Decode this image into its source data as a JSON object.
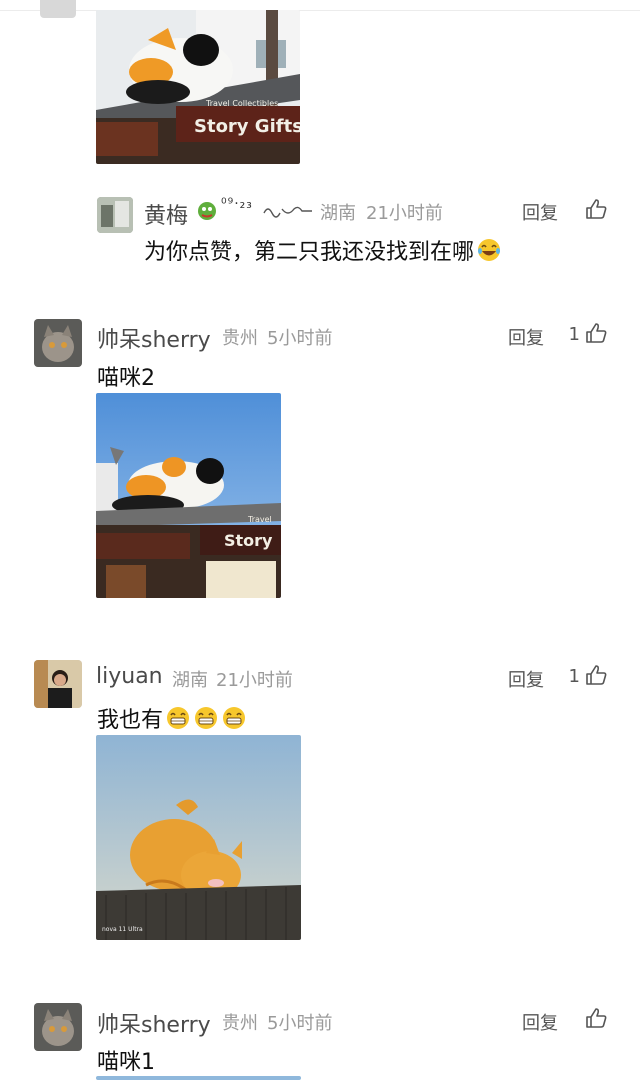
{
  "reply_label": "回复",
  "comments": [
    {
      "user": "黄梅",
      "name_suffix": "⁰⁹·₂₃",
      "location": "湖南",
      "time": "21小时前",
      "text": "为你点赞，第二只我还没找到在哪",
      "likes": ""
    },
    {
      "user": "帅呆sherry",
      "location": "贵州",
      "time": "5小时前",
      "text": "喵咪2",
      "likes": "1",
      "image": {
        "sign_en": "Story",
        "sign_small": "Travel"
      }
    },
    {
      "user": "liyuan",
      "location": "湖南",
      "time": "21小时前",
      "text": "我也有",
      "likes": "1",
      "image": {
        "watermark": "nova 11 Ultra"
      }
    },
    {
      "user": "帅呆sherry",
      "location": "贵州",
      "time": "5小时前",
      "text": "喵咪1",
      "likes": ""
    }
  ],
  "top_image": {
    "sign_en": "Story Gifts",
    "sign_small": "Travel Collectibles"
  },
  "icons": {
    "thumb": "thumbs-up-icon",
    "laugh": "laughing-emoji-icon",
    "grin": "grinning-emoji-icon",
    "dragon": "dragon-emoji-icon"
  },
  "colors": {
    "meta": "#9a9a9a",
    "username": "#4a4a4a"
  }
}
